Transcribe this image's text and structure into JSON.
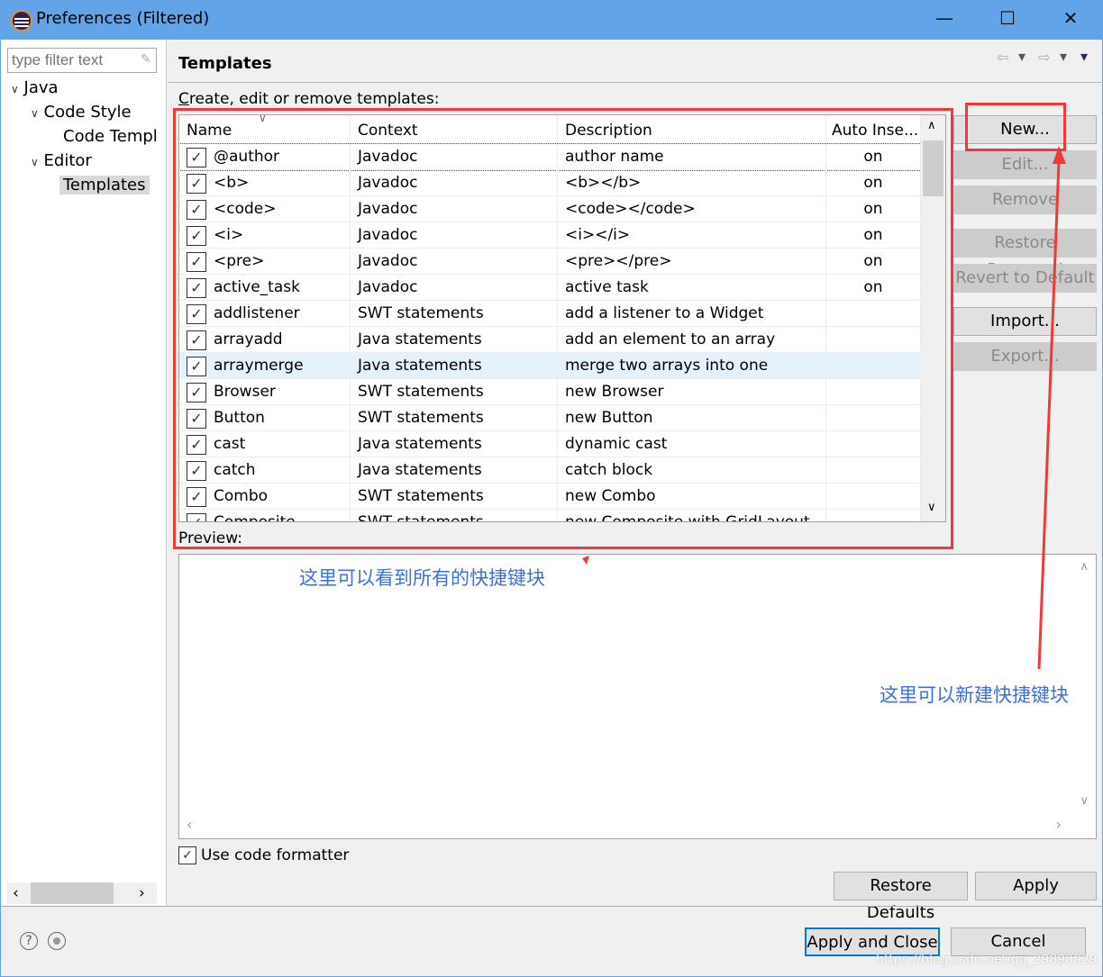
{
  "window": {
    "title": "Preferences (Filtered)",
    "minimize": "—",
    "maximize": "☐",
    "close": "✕"
  },
  "sidebar": {
    "filter_placeholder": "type filter text",
    "items": [
      {
        "label": "Java",
        "expanded": true
      },
      {
        "label": "Code Style",
        "expanded": true
      },
      {
        "label": "Code Templ"
      },
      {
        "label": "Editor",
        "expanded": true
      },
      {
        "label": "Templates",
        "selected": true
      }
    ]
  },
  "page": {
    "title": "Templates",
    "description_prefix": "C",
    "description_rest": "reate, edit or remove templates:",
    "nav": {
      "back": "⇦",
      "forward": "⇨",
      "dropdown": "▾"
    }
  },
  "table": {
    "columns": [
      "Name",
      "Context",
      "Description",
      "Auto Inse..."
    ],
    "rows": [
      {
        "name": "@author",
        "context": "Javadoc",
        "description": "author name",
        "auto": "on",
        "checked": true
      },
      {
        "name": "<b>",
        "context": "Javadoc",
        "description": "<b></b>",
        "auto": "on",
        "checked": true
      },
      {
        "name": "<code>",
        "context": "Javadoc",
        "description": "<code></code>",
        "auto": "on",
        "checked": true
      },
      {
        "name": "<i>",
        "context": "Javadoc",
        "description": "<i></i>",
        "auto": "on",
        "checked": true
      },
      {
        "name": "<pre>",
        "context": "Javadoc",
        "description": "<pre></pre>",
        "auto": "on",
        "checked": true
      },
      {
        "name": "active_task",
        "context": "Javadoc",
        "description": "active task",
        "auto": "on",
        "checked": true
      },
      {
        "name": "addlistener",
        "context": "SWT statements",
        "description": "add a listener to a Widget",
        "auto": "",
        "checked": true
      },
      {
        "name": "arrayadd",
        "context": "Java statements",
        "description": "add an element to an array",
        "auto": "",
        "checked": true
      },
      {
        "name": "arraymerge",
        "context": "Java statements",
        "description": "merge two arrays into one",
        "auto": "",
        "checked": true,
        "highlighted": true
      },
      {
        "name": "Browser",
        "context": "SWT statements",
        "description": "new Browser",
        "auto": "",
        "checked": true
      },
      {
        "name": "Button",
        "context": "SWT statements",
        "description": "new Button",
        "auto": "",
        "checked": true
      },
      {
        "name": "cast",
        "context": "Java statements",
        "description": "dynamic cast",
        "auto": "",
        "checked": true
      },
      {
        "name": "catch",
        "context": "Java statements",
        "description": "catch block",
        "auto": "",
        "checked": true
      },
      {
        "name": "Combo",
        "context": "SWT statements",
        "description": "new Combo",
        "auto": "",
        "checked": true
      },
      {
        "name": "Composite",
        "context": "SWT statements",
        "description": "new Composite with GridLayout",
        "auto": "",
        "checked": true
      }
    ]
  },
  "buttons": {
    "new": "New...",
    "edit": "Edit...",
    "remove": "Remove",
    "restore_removed": "Restore Removed",
    "revert": "Revert to Default",
    "import": "Import...",
    "export": "Export..."
  },
  "preview": {
    "label": "Preview:"
  },
  "annotations": {
    "table_note": "这里可以看到所有的快捷键块",
    "new_note": "这里可以新建快捷键块"
  },
  "use_formatter": {
    "label": "Use code formatter",
    "checked": true
  },
  "footer": {
    "restore_defaults": "Restore Defaults",
    "apply": "Apply",
    "apply_close": "Apply and Close",
    "cancel": "Cancel",
    "help": "?"
  },
  "watermark": "https://blog.csdn.net/qq_29890029",
  "colors": {
    "titlebar": "#63a4e8",
    "annotation": "#3d6fdb",
    "highlight": "#f03a3a"
  }
}
